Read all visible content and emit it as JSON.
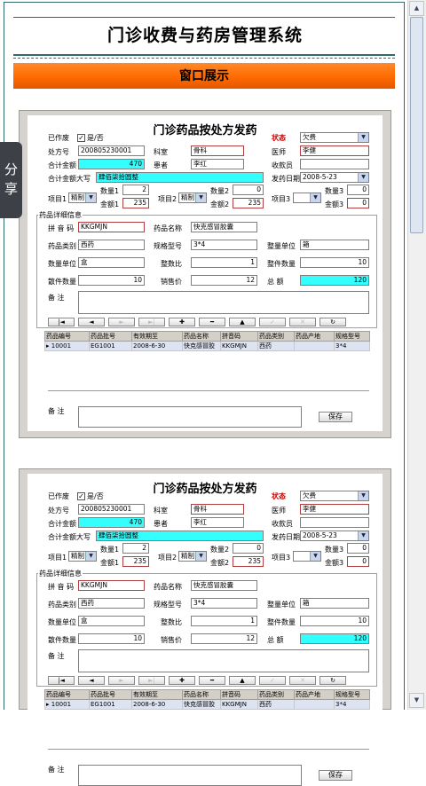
{
  "app": {
    "title": "门诊收费与药房管理系统",
    "banner": "窗口展示",
    "share": "分享"
  },
  "form": {
    "title": "门诊药品按处方发药",
    "labels": {
      "paid": "已作废",
      "yesno": "是/否",
      "rx_no": "处方号",
      "dept": "科室",
      "status": "状态",
      "doctor": "医师",
      "total": "合计金额",
      "patient": "患者",
      "cashier": "收款员",
      "total_upper": "合计金额大写",
      "dispense_date": "发药日期",
      "item1": "项目1",
      "qty1": "数量1",
      "amt1": "金额1",
      "item2": "项目2",
      "qty2": "数量2",
      "amt2": "金额2",
      "item3": "项目3",
      "qty3": "数量3",
      "amt3": "金额3",
      "detail": "药品详细信息",
      "pinyin": "拼 音 码",
      "drug_name": "药品名称",
      "drug_type": "药品类别",
      "spec": "规格型号",
      "pack_unit": "整量单位",
      "unit": "数量单位",
      "ratio": "整数比",
      "pack_qty": "整件数量",
      "loose_qty": "散件数量",
      "price": "销售价",
      "sum": "总  额",
      "remark": "备  注",
      "remark2": "备  注",
      "save": "保存"
    },
    "values": {
      "checkbox": "✓",
      "rx_no": "200805230001",
      "dept": "骨科",
      "status": "欠费",
      "doctor": "李健",
      "total": "470",
      "patient": "李红",
      "cashier": "",
      "total_upper": "肆佰柒拾圆整",
      "dispense_date": "2008-5-23",
      "item1": "精制",
      "qty1": "2",
      "amt1": "235",
      "item2": "精制",
      "qty2": "0",
      "amt2": "235",
      "item3": "",
      "qty3": "0",
      "amt3": "0",
      "pinyin": "KKGMJN",
      "drug_name": "快克感冒胶囊",
      "drug_type": "西药",
      "spec": "3*4",
      "pack_unit": "箱",
      "unit": "盒",
      "ratio": "1",
      "pack_qty": "10",
      "loose_qty": "10",
      "price": "12",
      "sum": "120",
      "remark": ""
    },
    "nav": [
      "|◄",
      "◄",
      "►",
      "►|",
      "✚",
      "━",
      "▲",
      "✓",
      "✕",
      "↻"
    ],
    "table": {
      "headers": [
        "药品编号",
        "药品批号",
        "有效期至",
        "药品名称",
        "拼音码",
        "药品类别",
        "药品产地",
        "规格型号"
      ],
      "rows": [
        [
          "10001",
          "EG1001",
          "2008-6-30",
          "快克感冒胶",
          "KKGMJN",
          "西药",
          "",
          "3*4"
        ]
      ],
      "marker": "▸"
    }
  },
  "colors": {
    "accent": "#ff7a10",
    "highlight": "#33ffff",
    "status_red": "#c00000"
  },
  "scrollbar": {
    "up": "▲",
    "down": "▼"
  }
}
